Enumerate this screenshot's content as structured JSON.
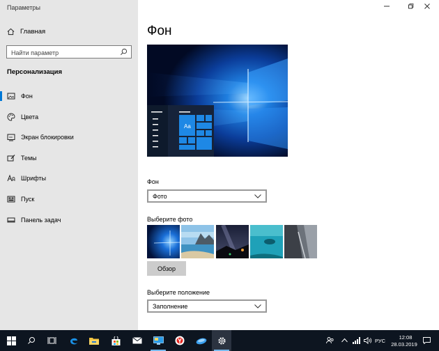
{
  "window": {
    "title": "Параметры",
    "minimize_icon": "minimize-icon",
    "maximize_icon": "maximize-icon",
    "close_icon": "close-icon"
  },
  "sidebar": {
    "home_label": "Главная",
    "search_placeholder": "Найти параметр",
    "section_title": "Персонализация",
    "items": [
      {
        "label": "Фон",
        "icon": "picture-icon",
        "active": true
      },
      {
        "label": "Цвета",
        "icon": "palette-icon"
      },
      {
        "label": "Экран блокировки",
        "icon": "lock-screen-icon"
      },
      {
        "label": "Темы",
        "icon": "brush-icon"
      },
      {
        "label": "Шрифты",
        "icon": "font-icon"
      },
      {
        "label": "Пуск",
        "icon": "start-icon"
      },
      {
        "label": "Панель задач",
        "icon": "taskbar-icon"
      }
    ]
  },
  "main": {
    "title": "Фон",
    "preview_tile_label": "Aa",
    "background_label": "Фон",
    "background_value": "Фото",
    "choose_photo_label": "Выберите фото",
    "browse_label": "Обзор",
    "position_label": "Выберите положение",
    "position_value": "Заполнение"
  },
  "taskbar": {
    "apps": [
      "windows-start-icon",
      "search-icon",
      "task-view-icon",
      "edge-icon",
      "file-explorer-icon",
      "store-icon",
      "mail-icon",
      "remote-desktop-icon",
      "yandex-browser-icon",
      "cloud-app-icon",
      "settings-icon"
    ],
    "language": "РУС",
    "time": "12:08",
    "date": "28.03.2019"
  },
  "colors": {
    "accent": "#0078d7",
    "sidebar_bg": "#e6e6e6",
    "taskbar_bg": "#0d1520"
  }
}
